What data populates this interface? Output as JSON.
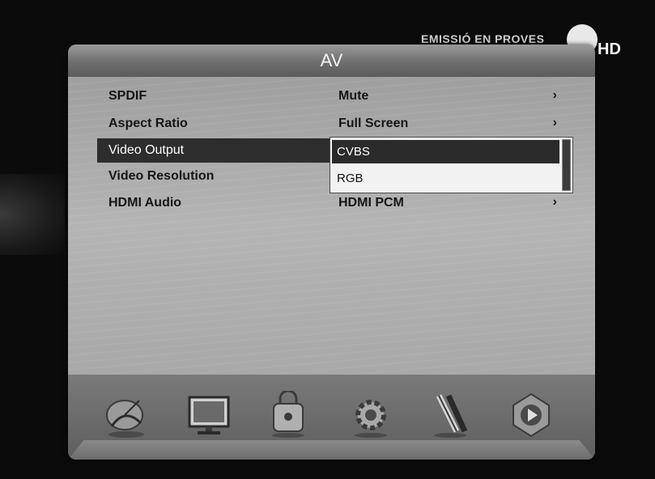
{
  "channel": {
    "banner": "EMISSIÓ EN PROVES",
    "badge": "HD"
  },
  "menu": {
    "title": "AV",
    "rows": [
      {
        "label": "SPDIF",
        "value": "Mute",
        "chevron": "›"
      },
      {
        "label": "Aspect Ratio",
        "value": "Full Screen",
        "chevron": "›"
      },
      {
        "label": "Video Output",
        "value": "",
        "chevron": ""
      },
      {
        "label": "Video Resolution",
        "value": "",
        "chevron": ""
      },
      {
        "label": "HDMI Audio",
        "value": "HDMI PCM",
        "chevron": "›"
      }
    ],
    "selected_row": "Video Output"
  },
  "dropdown": {
    "options": [
      "CVBS",
      "RGB"
    ],
    "selected": "CVBS"
  },
  "dock": {
    "icons": [
      "satellite-dish-icon",
      "monitor-icon",
      "parental-lock-icon",
      "settings-gear-icon",
      "av-cables-icon",
      "media-play-icon"
    ]
  },
  "colors": {
    "panel": "#7c7c7c",
    "selection": "#2d2d2d",
    "dropdown": "#f2f2f2"
  }
}
